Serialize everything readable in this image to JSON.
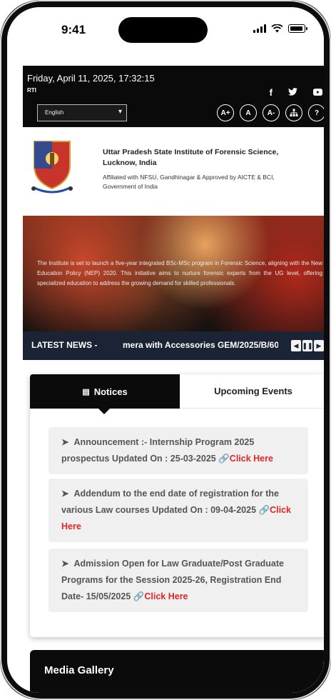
{
  "status_bar": {
    "time": "9:41"
  },
  "topbar": {
    "datetime": "Friday, April 11, 2025, 17:32:15",
    "rti": "RTI",
    "social_icons": [
      "facebook-icon",
      "twitter-icon",
      "youtube-icon"
    ],
    "language_value": "English",
    "accessibility_buttons": [
      "A+",
      "A",
      "A-"
    ]
  },
  "brand": {
    "name": "Uttar Pradesh State Institute of Forensic Science, Lucknow, India",
    "affiliation": "Affiliated with NFSU, Gandhinagar & Approved by AICTE & BCI, Government of India"
  },
  "hero": {
    "text": "The Institute is set to launch a five-year integrated BSc-MSc program in Forensic Science, aligning with the New Education Policy (NEP) 2020. This initiative aims to nurture forensic experts from the UG level, offering specialized education to address the growing demand for skilled professionals."
  },
  "ticker": {
    "label": "LATEST NEWS -",
    "text": "mera with Accessories GEM/2025/B/60"
  },
  "tabs": {
    "notices_label": "Notices",
    "events_label": "Upcoming Events"
  },
  "notices": [
    {
      "text": "Announcement :- Internship Program 2025 prospectus Updated On : 25-03-2025",
      "link": "Click Here"
    },
    {
      "text": "Addendum to the end date of registration for the various Law courses Updated On : 09-04-2025",
      "link": "Click Here"
    },
    {
      "text": "Admission Open for Law Graduate/Post Graduate Programs for the Session 2025-26, Registration End Date- 15/05/2025",
      "link": "Click Here"
    }
  ],
  "media": {
    "title": "Media Gallery"
  },
  "colors": {
    "topbar": "#0a0a0a",
    "ticker": "#1b2434",
    "link": "#e42525",
    "notice_bg": "#f0f0f0"
  }
}
